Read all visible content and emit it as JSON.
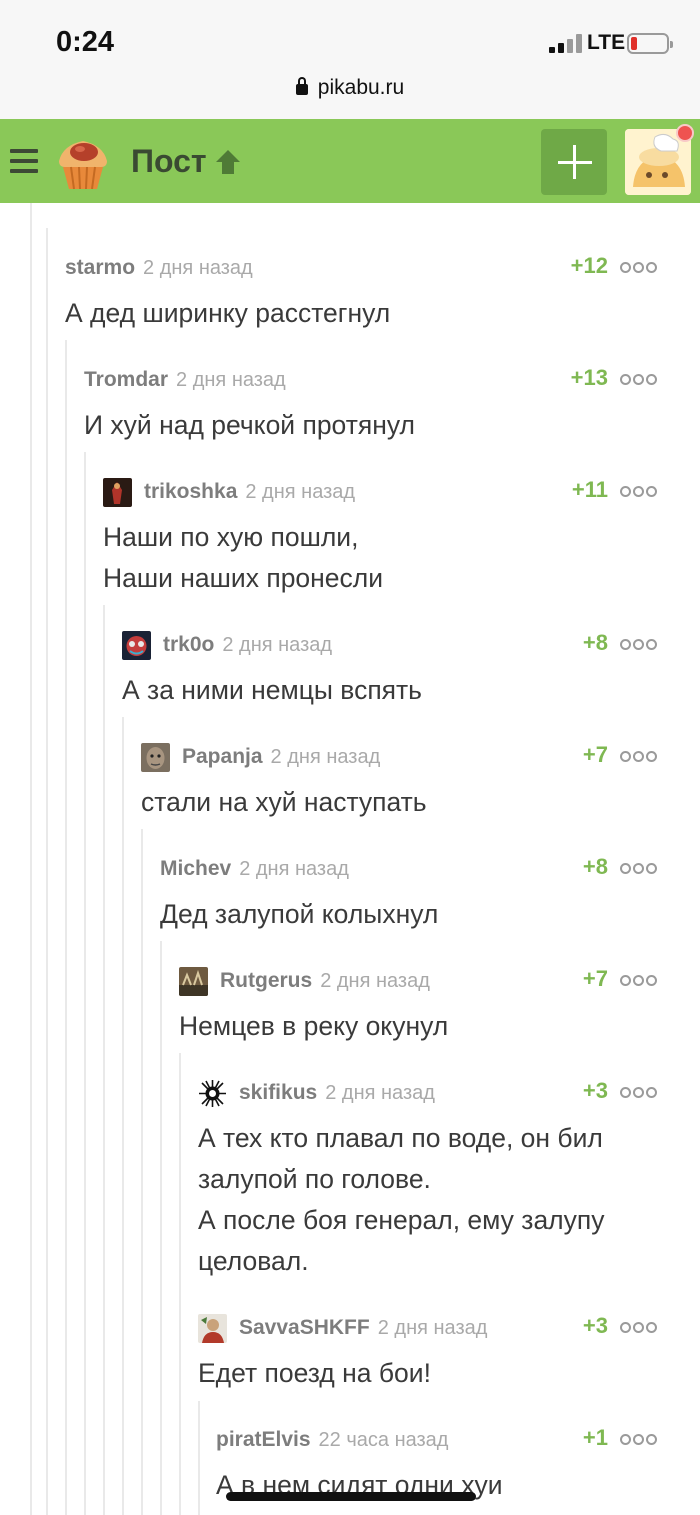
{
  "status_bar": {
    "time": "0:24",
    "network": "LTE",
    "battery_level": 0.18,
    "battery_color": "#e0302a"
  },
  "browser": {
    "url": "pikabu.ru"
  },
  "header": {
    "title": "Пост",
    "bg_color": "#8ac858",
    "icons": [
      "menu-icon",
      "cupcake-logo-icon",
      "arrow-up-icon",
      "plus-icon",
      "user-avatar"
    ]
  },
  "comments": [
    {
      "user": "starmo",
      "time": "2 дня назад",
      "rating": "+12",
      "avatar": "",
      "lines": [
        "А дед ширинку расстегнул"
      ]
    },
    {
      "user": "Tromdar",
      "time": "2 дня назад",
      "rating": "+13",
      "avatar": "",
      "lines": [
        "И хуй над речкой протянул"
      ]
    },
    {
      "user": "trikoshka",
      "time": "2 дня назад",
      "rating": "+11",
      "avatar": "avatar-red-figure",
      "lines": [
        "Наши по хую пошли,",
        "Наши наших пронесли"
      ]
    },
    {
      "user": "trk0o",
      "time": "2 дня назад",
      "rating": "+8",
      "avatar": "avatar-clown-mask",
      "lines": [
        "А за ними немцы вспять"
      ]
    },
    {
      "user": "Papanja",
      "time": "2 дня назад",
      "rating": "+7",
      "avatar": "avatar-face",
      "lines": [
        "стали на хуй наступать"
      ]
    },
    {
      "user": "Michev",
      "time": "2 дня назад",
      "rating": "+8",
      "avatar": "",
      "lines": [
        "Дед залупой колыхнул"
      ]
    },
    {
      "user": "Rutgerus",
      "time": "2 дня назад",
      "rating": "+7",
      "avatar": "avatar-battle-scene",
      "lines": [
        "Немцев в реку окунул"
      ]
    },
    {
      "user": "skifikus",
      "time": "2 дня назад",
      "rating": "+3",
      "avatar": "avatar-sun-emblem",
      "lines": [
        "А тех кто плавал по воде, он бил",
        "залупой по голове.",
        "А после боя генерал, ему залупу",
        "целовал."
      ]
    },
    {
      "user": "SavvaSHKFF",
      "time": "2 дня назад",
      "rating": "+3",
      "avatar": "avatar-photo",
      "lines": [
        "Едет поезд на бои!"
      ]
    },
    {
      "user": "piratElvis",
      "time": "22 часа назад",
      "rating": "+1",
      "avatar": "",
      "lines": [
        "А в нем сидят одни хуи"
      ]
    }
  ],
  "colors": {
    "rating": "#7fb852",
    "username": "#7d7d7d",
    "time": "#a9a9a9"
  }
}
